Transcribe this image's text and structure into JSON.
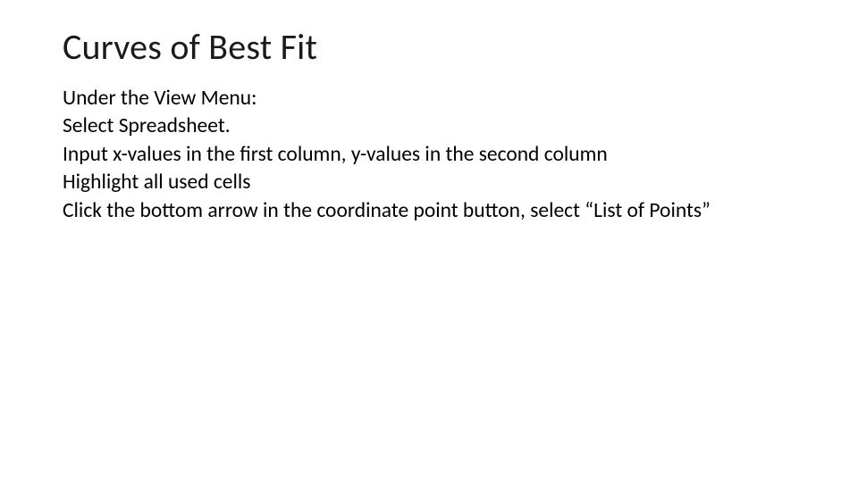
{
  "slide": {
    "title": "Curves of Best Fit",
    "lines": [
      "Under the View Menu:",
      "Select Spreadsheet.",
      "Input x-values in the first column, y-values in the second column",
      "Highlight all used cells",
      "Click the bottom arrow in the coordinate point button, select “List of Points”"
    ]
  }
}
